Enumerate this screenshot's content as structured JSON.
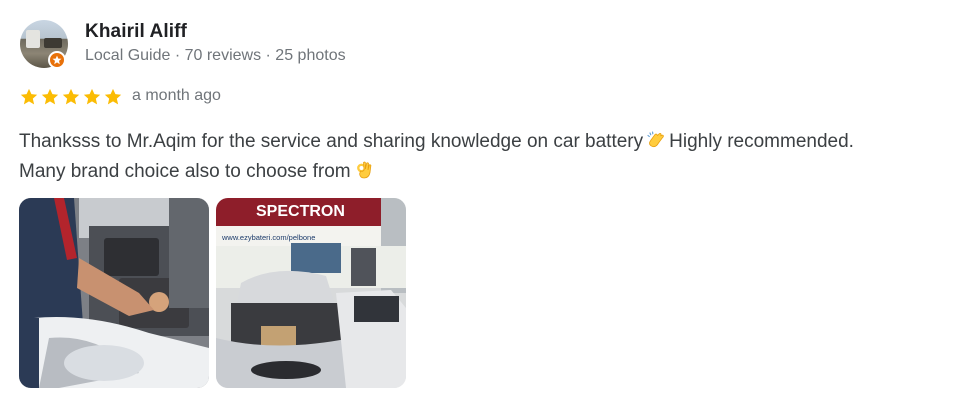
{
  "reviewer": {
    "name": "Khairil Aliff",
    "meta": "Local Guide · 70 reviews · 25 photos",
    "avatar_icon": "user-avatar",
    "badge_icon": "local-guide-star-icon"
  },
  "rating": {
    "stars": 5,
    "max": 5,
    "color": "#fbbc04"
  },
  "time_ago": "a month ago",
  "review_text": {
    "line1_a": "Thanksss to Mr.Aqim for the service and sharing knowledge on car battery",
    "line1_emoji": "clapping-hands-emoji",
    "line1_b": "Highly recommended.",
    "line2_a": "Many brand choice also to choose from",
    "line2_emoji": "ok-hand-emoji"
  },
  "photos": [
    {
      "icon": "photo-car-battery-service"
    },
    {
      "icon": "photo-shop-front",
      "sign_text": "SPECTRON",
      "url_text": "www.ezybateri.com/pelbone"
    }
  ]
}
